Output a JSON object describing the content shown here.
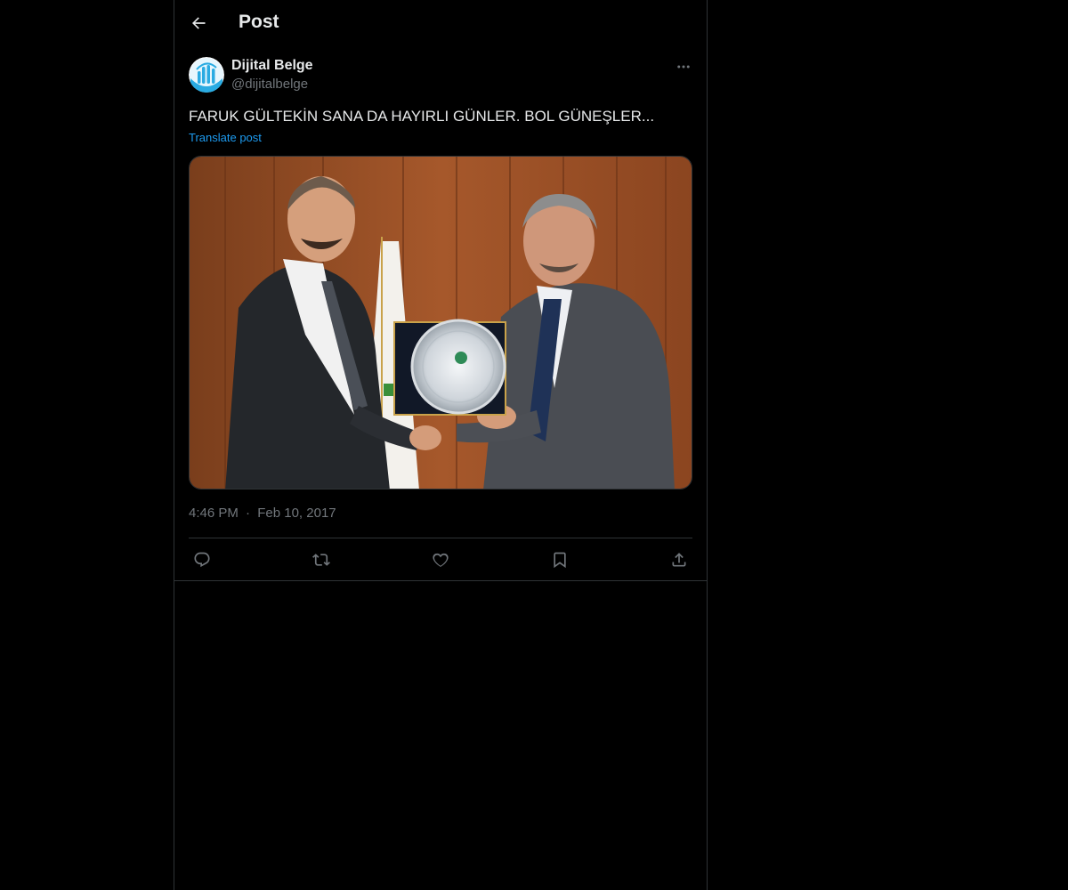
{
  "header": {
    "title": "Post",
    "back_icon": "arrow-left-icon"
  },
  "post": {
    "author": {
      "display_name": "Dijital Belge",
      "handle": "@dijitalbelge",
      "avatar_icon": "dijital-belge-logo"
    },
    "more_icon": "more-horizontal-icon",
    "text": "FARUK GÜLTEKİN SANA DA HAYIRLI GÜNLER. BOL GÜNEŞLER...",
    "translate_label": "Translate post",
    "image": "photo of two men in suits shaking hands while holding a silver award plaque",
    "time": "4:46 PM",
    "separator": "·",
    "date": "Feb 10, 2017",
    "actions": [
      {
        "name": "reply",
        "icon": "reply-icon"
      },
      {
        "name": "repost",
        "icon": "repost-icon"
      },
      {
        "name": "like",
        "icon": "heart-icon"
      },
      {
        "name": "bookmark",
        "icon": "bookmark-icon"
      },
      {
        "name": "share",
        "icon": "share-icon"
      }
    ]
  },
  "colors": {
    "background": "#000000",
    "border": "#2f3336",
    "text_primary": "#e7e9ea",
    "text_secondary": "#71767b",
    "accent": "#1d9bf0"
  }
}
